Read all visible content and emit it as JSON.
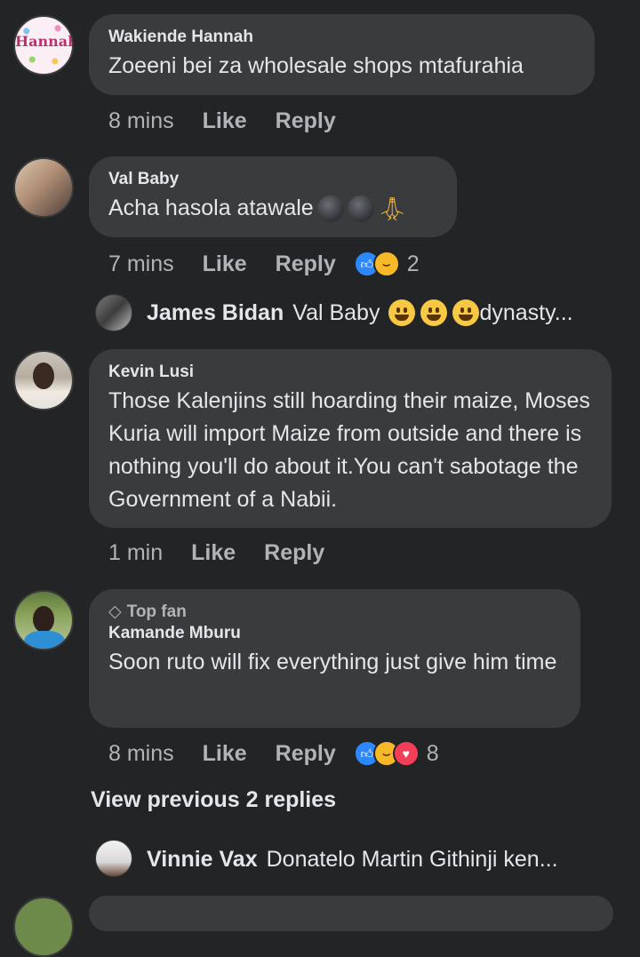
{
  "comments": [
    {
      "name": "Wakiende Hannah",
      "text": "Zoeeni bei za wholesale shops mtafurahia",
      "time": "8 mins",
      "like": "Like",
      "reply": "Reply",
      "avatar_label": "Hannah"
    },
    {
      "name": "Val Baby",
      "text": "Acha hasola atawale",
      "time": "7 mins",
      "like": "Like",
      "reply": "Reply",
      "reaction_count": "2",
      "reactions": [
        "like",
        "haha"
      ],
      "reply_preview": {
        "name": "James Bidan",
        "text_start": "Val Baby",
        "text_end": "dynasty..."
      }
    },
    {
      "name": "Kevin Lusi",
      "text": "Those Kalenjins still hoarding their maize, Moses Kuria will import Maize from outside and there is nothing you'll do about it.You can't sabotage the Government of a Nabii.",
      "time": "1 min",
      "like": "Like",
      "reply": "Reply"
    },
    {
      "badge": "Top fan",
      "name": "Kamande Mburu",
      "text": "Soon ruto will fix everything just give him time",
      "time": "8 mins",
      "like": "Like",
      "reply": "Reply",
      "reaction_count": "8",
      "reactions": [
        "like",
        "haha",
        "love"
      ],
      "view_previous": "View previous 2 replies",
      "reply_preview": {
        "name": "Vinnie Vax",
        "text": "Donatelo Martin Githinji ken..."
      }
    }
  ],
  "colors": {
    "background": "#232426",
    "bubble": "#3a3b3c",
    "primary_text": "#e4e6eb",
    "secondary_text": "#b0b3b8",
    "like_blue": "#2d88ff",
    "haha_yellow": "#f7b928",
    "love_red": "#f33e58"
  }
}
